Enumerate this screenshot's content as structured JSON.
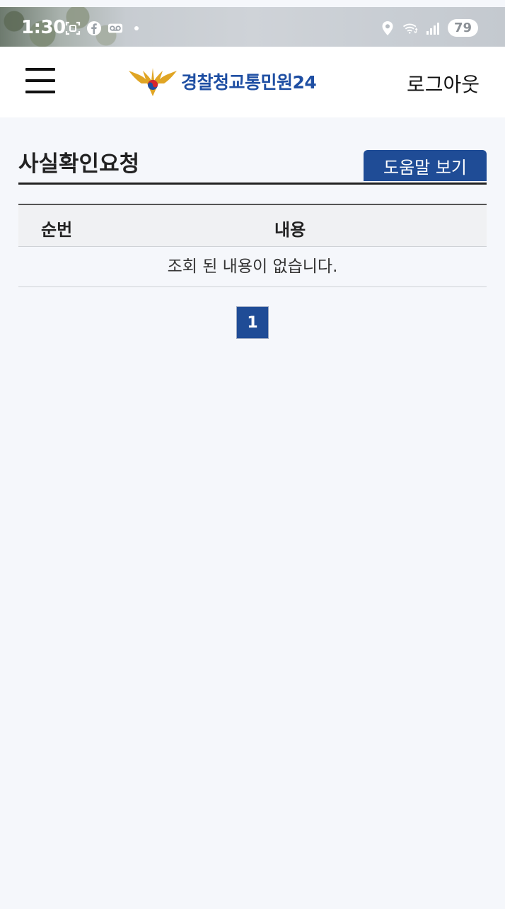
{
  "status_bar": {
    "time": "1:30",
    "battery": "79"
  },
  "header": {
    "logo_text": "경찰청교통민원24",
    "logout_label": "로그아웃"
  },
  "page": {
    "title": "사실확인요청",
    "help_label": "도움말 보기"
  },
  "table": {
    "columns": [
      "순번",
      "내용"
    ],
    "empty_message": "조회 된 내용이 없습니다."
  },
  "pagination": {
    "current_page": "1"
  },
  "colors": {
    "accent": "#1f4c96",
    "logo_text": "#1f4fa3",
    "background": "#f5f7fb"
  },
  "icons": {
    "status_left": [
      "screenshot-icon",
      "facebook-icon",
      "voicemail-icon",
      "dot-icon"
    ],
    "status_right": [
      "location-icon",
      "wifi-icon",
      "signal-icon"
    ]
  }
}
